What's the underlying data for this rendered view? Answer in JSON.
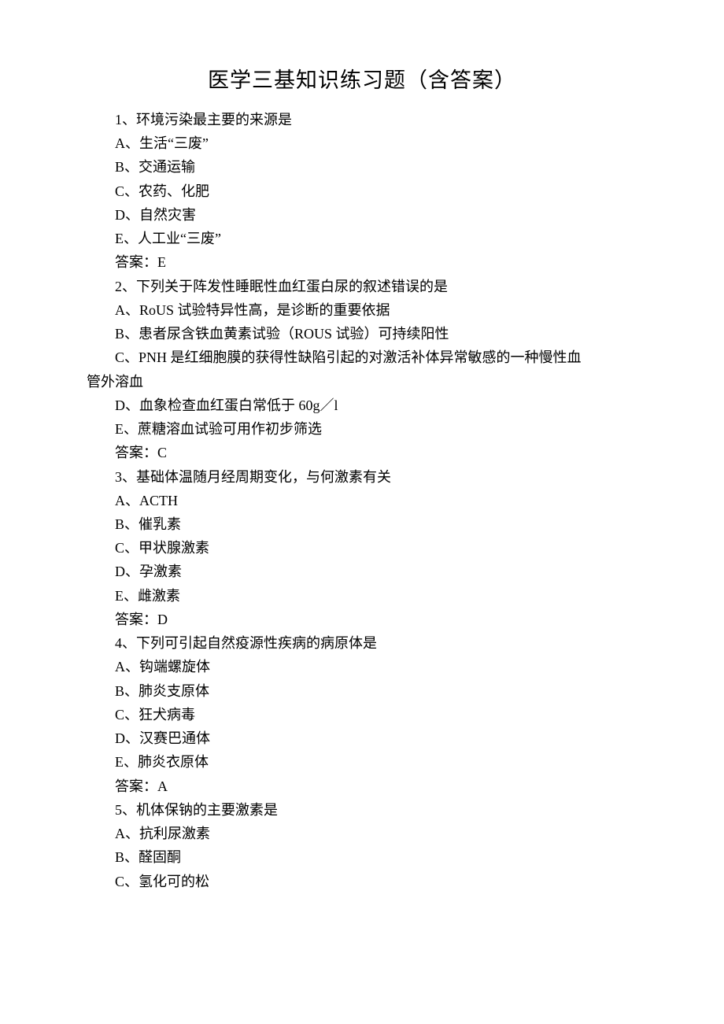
{
  "title": "医学三基知识练习题（含答案）",
  "questions": [
    {
      "num": "1、",
      "stem": "环境污染最主要的来源是",
      "options": [
        "A、生活“三废”",
        "B、交通运输",
        "C、农药、化肥",
        "D、自然灾害",
        "E、人工业“三废”"
      ],
      "answer": "答案：E"
    },
    {
      "num": "2、",
      "stem": "下列关于阵发性睡眠性血红蛋白尿的叙述错误的是",
      "options": [
        "A、RoUS 试验特异性高，是诊断的重要依据",
        "B、患者尿含铁血黄素试验（ROUS 试验）可持续阳性",
        "C、PNH 是红细胞膜的获得性缺陷引起的对激活补体异常敏感的一种慢性血\n管外溶血",
        "D、血象检查血红蛋白常低于 60g／l",
        "E、蔗糖溶血试验可用作初步筛选"
      ],
      "answer": "答案：C"
    },
    {
      "num": "3、",
      "stem": "基础体温随月经周期变化，与何激素有关",
      "options": [
        "A、ACTH",
        "B、催乳素",
        "C、甲状腺激素",
        "D、孕激素",
        "E、雌激素"
      ],
      "answer": "答案：D"
    },
    {
      "num": "4、",
      "stem": "下列可引起自然疫源性疾病的病原体是",
      "options": [
        "A、钩端螺旋体",
        "B、肺炎支原体",
        "C、狂犬病毒",
        "D、汉赛巴通体",
        "E、肺炎衣原体"
      ],
      "answer": "答案：A"
    },
    {
      "num": "5、",
      "stem": "机体保钠的主要激素是",
      "options": [
        "A、抗利尿激素",
        "B、醛固酮",
        "C、氢化可的松"
      ],
      "answer": null
    }
  ]
}
